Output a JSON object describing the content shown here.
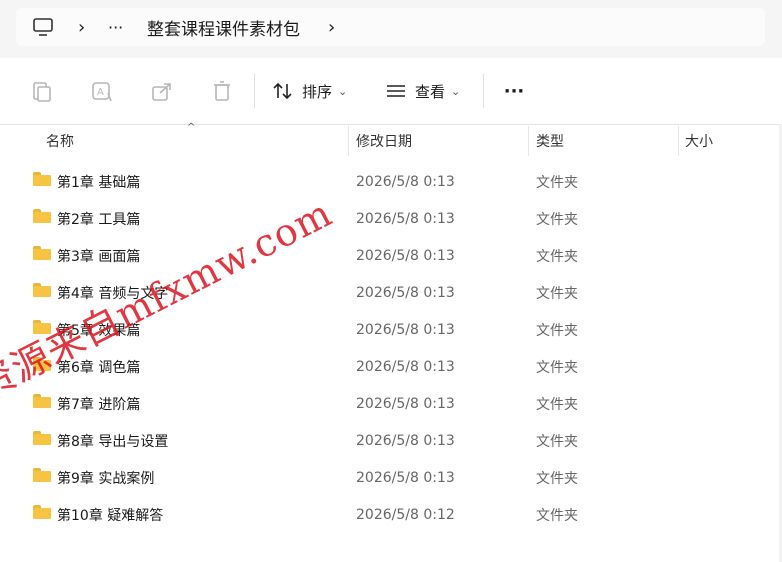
{
  "address": {
    "monitor_icon": "monitor-icon",
    "chevron": "›",
    "more": "···",
    "folder_name": "整套课程课件素材包",
    "trail_chevron": "›"
  },
  "toolbar": {
    "copy_icon": "clipboard-icon",
    "rename_icon": "rename-icon",
    "share_icon": "share-icon",
    "delete_icon": "trash-icon",
    "sort_label": "排序",
    "view_label": "查看",
    "more_label": "···"
  },
  "columns": {
    "name": "名称",
    "date": "修改日期",
    "type": "类型",
    "size": "大小"
  },
  "files": [
    {
      "name": "第1章 基础篇",
      "date": "2026/5/8 0:13",
      "type": "文件夹"
    },
    {
      "name": "第2章 工具篇",
      "date": "2026/5/8 0:13",
      "type": "文件夹"
    },
    {
      "name": "第3章 画面篇",
      "date": "2026/5/8 0:13",
      "type": "文件夹"
    },
    {
      "name": "第4章 音频与文字",
      "date": "2026/5/8 0:13",
      "type": "文件夹"
    },
    {
      "name": "第5章 效果篇",
      "date": "2026/5/8 0:13",
      "type": "文件夹"
    },
    {
      "name": "第6章 调色篇",
      "date": "2026/5/8 0:13",
      "type": "文件夹"
    },
    {
      "name": "第7章 进阶篇",
      "date": "2026/5/8 0:13",
      "type": "文件夹"
    },
    {
      "name": "第8章 导出与设置",
      "date": "2026/5/8 0:13",
      "type": "文件夹"
    },
    {
      "name": "第9章 实战案例",
      "date": "2026/5/8 0:13",
      "type": "文件夹"
    },
    {
      "name": "第10章 疑难解答",
      "date": "2026/5/8 0:12",
      "type": "文件夹"
    }
  ],
  "watermark": "资源来自mfxmw.com",
  "colors": {
    "folder": "#f6c343",
    "watermark": "#dc141e"
  }
}
